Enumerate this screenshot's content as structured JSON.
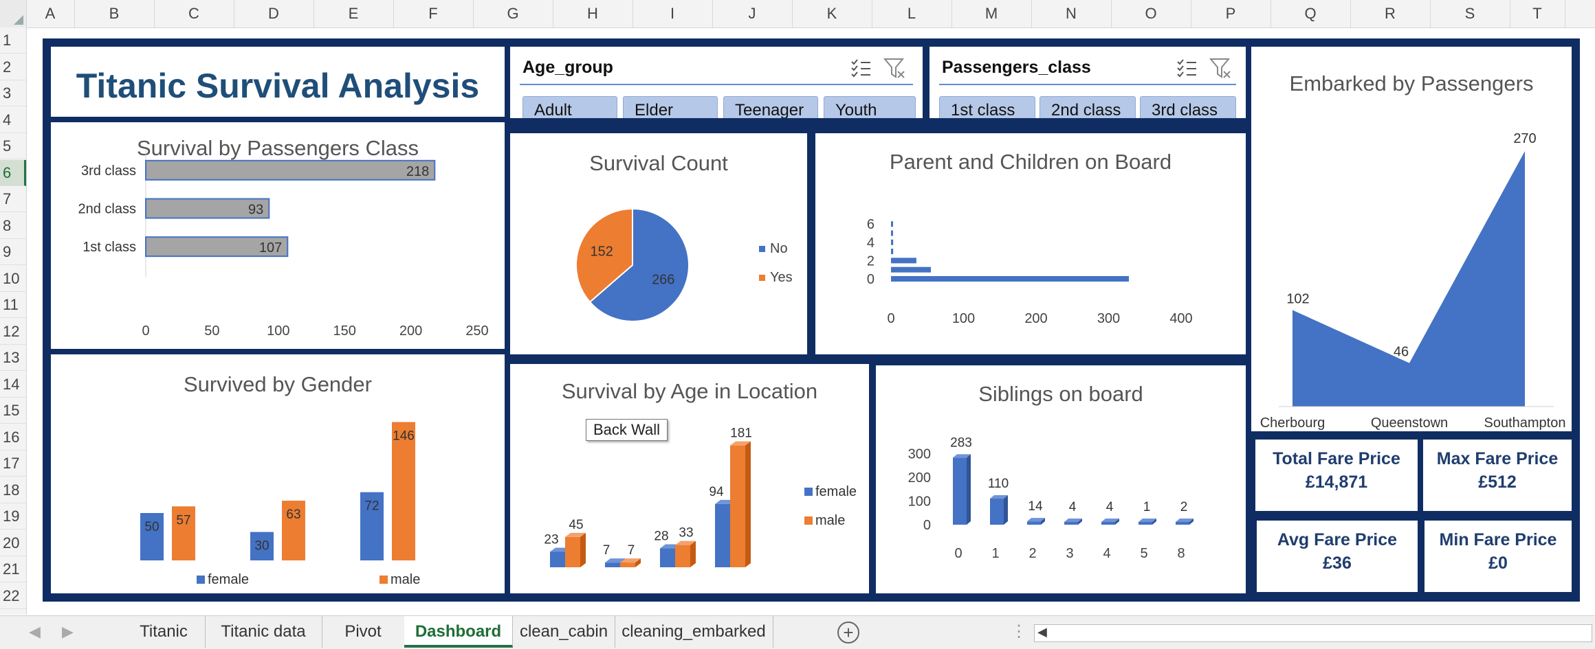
{
  "columns": [
    "A",
    "B",
    "C",
    "D",
    "E",
    "F",
    "G",
    "H",
    "I",
    "J",
    "K",
    "L",
    "M",
    "N",
    "O",
    "P",
    "Q",
    "R",
    "S",
    "T"
  ],
  "rows": [
    "1",
    "2",
    "3",
    "4",
    "5",
    "6",
    "7",
    "8",
    "9",
    "10",
    "11",
    "12",
    "13",
    "14",
    "15",
    "16",
    "17",
    "18",
    "19",
    "20",
    "21",
    "22"
  ],
  "selected_row": "6",
  "dashboard": {
    "title": "Titanic Survival Analysis",
    "age_slicer": {
      "header": "Age_group",
      "items": [
        "Adult",
        "Elder",
        "Teenager",
        "Youth"
      ]
    },
    "class_slicer": {
      "header": "Passengers_class",
      "items": [
        "1st class",
        "2nd class",
        "3rd class"
      ]
    },
    "tooltip": "Back Wall",
    "kpis": [
      {
        "label": "Total Fare Price",
        "value": "£14,871"
      },
      {
        "label": "Max Fare Price",
        "value": "£512"
      },
      {
        "label": "Avg Fare Price",
        "value": "£36"
      },
      {
        "label": "Min Fare Price",
        "value": "£0"
      }
    ]
  },
  "chart_data": [
    {
      "id": "class",
      "type": "bar",
      "title": "Survival by Passengers Class",
      "categories": [
        "3rd class",
        "2nd class",
        "1st class"
      ],
      "values": [
        218,
        93,
        107
      ],
      "xlim": [
        0,
        250
      ],
      "xticks": [
        "0",
        "50",
        "100",
        "150",
        "200",
        "250"
      ],
      "colors": {
        "bar": "#a5a5a5",
        "edge": "#4472c4"
      }
    },
    {
      "id": "count",
      "type": "pie",
      "title": "Survival Count",
      "labels": [
        "No",
        "Yes"
      ],
      "values": [
        266,
        152
      ],
      "colors": [
        "#4472c4",
        "#ed7d31"
      ],
      "legend": "right"
    },
    {
      "id": "parch",
      "type": "bar",
      "title": "Parent and Children on Board",
      "categories": [
        "0",
        "1",
        "2",
        "3",
        "4",
        "5",
        "6"
      ],
      "values": [
        328,
        55,
        35,
        3,
        3,
        1,
        1
      ],
      "yticks": [
        "0",
        "2",
        "4",
        "6"
      ],
      "xticks": [
        "0",
        "100",
        "200",
        "300",
        "400"
      ],
      "xlim": [
        0,
        400
      ],
      "colors": {
        "bar": "#4472c4"
      }
    },
    {
      "id": "embarked",
      "type": "area",
      "title": "Embarked by Passengers",
      "categories": [
        "Cherbourg",
        "Queenstown",
        "Southampton"
      ],
      "values": [
        102,
        46,
        270
      ],
      "colors": {
        "fill": "#4472c4"
      }
    },
    {
      "id": "gender",
      "type": "bar",
      "title": "Survived by Gender",
      "groups": 3,
      "series": [
        {
          "name": "female",
          "values": [
            50,
            30,
            72
          ],
          "color": "#4472c4"
        },
        {
          "name": "male",
          "values": [
            57,
            63,
            146
          ],
          "color": "#ed7d31"
        }
      ],
      "legend": "bottom"
    },
    {
      "id": "age",
      "type": "bar",
      "title": "Survival by Age in Location",
      "groups": 4,
      "series": [
        {
          "name": "female",
          "values": [
            23,
            7,
            28,
            94
          ],
          "color": "#4472c4"
        },
        {
          "name": "male",
          "values": [
            45,
            7,
            33,
            181
          ],
          "color": "#ed7d31"
        }
      ],
      "legend": "right"
    },
    {
      "id": "sib",
      "type": "bar",
      "title": "Siblings on board",
      "categories": [
        "0",
        "1",
        "2",
        "3",
        "4",
        "5",
        "8"
      ],
      "values": [
        283,
        110,
        14,
        4,
        4,
        1,
        2
      ],
      "yticks": [
        "0",
        "100",
        "200",
        "300"
      ],
      "ylim": [
        0,
        300
      ],
      "colors": {
        "bar": "#4472c4"
      }
    }
  ],
  "tabs": [
    "Titanic",
    "Titanic data",
    "Pivot",
    "Dashboard",
    "clean_cabin",
    "cleaning_embarked"
  ],
  "active_tab": "Dashboard"
}
